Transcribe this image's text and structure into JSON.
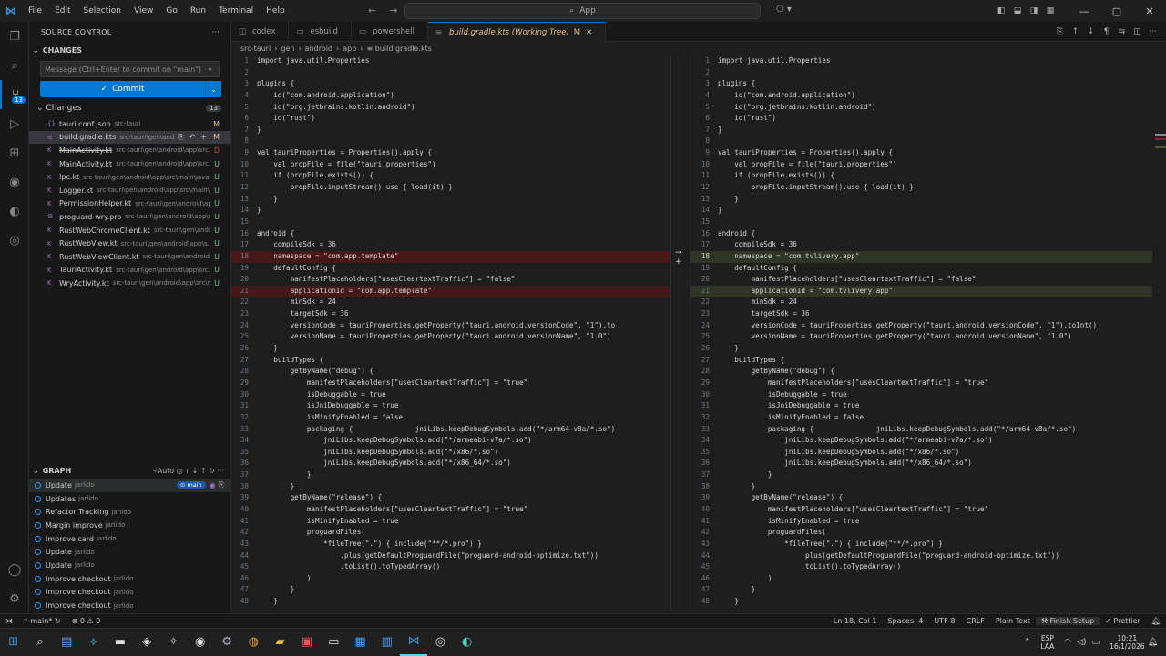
{
  "titlebar": {
    "menu": [
      "File",
      "Edit",
      "Selection",
      "View",
      "Go",
      "Run",
      "Terminal",
      "Help"
    ],
    "search": "App"
  },
  "scm": {
    "title": "SOURCE CONTROL",
    "section": "CHANGES",
    "message_placeholder": "Message (Ctrl+Enter to commit on \"main\")",
    "commit_label": "Commit",
    "changes_label": "Changes",
    "changes_count": "13",
    "files": [
      {
        "name": "tauri.conf.json",
        "path": "src-tauri",
        "status": "M",
        "icon": "{}",
        "deleted": false
      },
      {
        "name": "build.gradle.kts",
        "path": "src-tauri\\gen\\androi...",
        "status": "M",
        "icon": "≡",
        "deleted": false
      },
      {
        "name": "MainActivity.kt",
        "path": "src-tauri\\gen\\android\\app\\src...",
        "status": "D",
        "icon": "K",
        "deleted": true
      },
      {
        "name": "MainActivity.kt",
        "path": "src-tauri\\gen\\android\\app\\src...",
        "status": "U",
        "icon": "K",
        "deleted": false
      },
      {
        "name": "Ipc.kt",
        "path": "src-tauri\\gen\\android\\app\\src\\main\\java...",
        "status": "U",
        "icon": "K",
        "deleted": false
      },
      {
        "name": "Logger.kt",
        "path": "src-tauri\\gen\\android\\app\\src\\main\\j...",
        "status": "U",
        "icon": "K",
        "deleted": false
      },
      {
        "name": "PermissionHelper.kt",
        "path": "src-tauri\\gen\\android\\app...",
        "status": "U",
        "icon": "K",
        "deleted": false
      },
      {
        "name": "proguard-wry.pro",
        "path": "src-tauri\\gen\\android\\app\\s...",
        "status": "U",
        "icon": "⚙",
        "deleted": false
      },
      {
        "name": "RustWebChromeClient.kt",
        "path": "src-tauri\\gen\\androi...",
        "status": "U",
        "icon": "K",
        "deleted": false
      },
      {
        "name": "RustWebView.kt",
        "path": "src-tauri\\gen\\android\\app\\s...",
        "status": "U",
        "icon": "K",
        "deleted": false
      },
      {
        "name": "RustWebViewClient.kt",
        "path": "src-tauri\\gen\\android...",
        "status": "U",
        "icon": "K",
        "deleted": false
      },
      {
        "name": "TauriActivity.kt",
        "path": "src-tauri\\gen\\android\\app\\src...",
        "status": "U",
        "icon": "K",
        "deleted": false
      },
      {
        "name": "WryActivity.kt",
        "path": "src-tauri\\gen\\android\\app\\src\\m...",
        "status": "U",
        "icon": "K",
        "deleted": false
      }
    ],
    "graph_title": "GRAPH",
    "graph_auto": "Auto",
    "branch": "main",
    "commits": [
      {
        "msg": "Update",
        "author": "jarlido"
      },
      {
        "msg": "Updates",
        "author": "jarlido"
      },
      {
        "msg": "Refactor Tracking",
        "author": "jarlido"
      },
      {
        "msg": "Margin improve",
        "author": "jarlido"
      },
      {
        "msg": "Improve card",
        "author": "jarlido"
      },
      {
        "msg": "Update",
        "author": "jarlido"
      },
      {
        "msg": "Update",
        "author": "jarlido"
      },
      {
        "msg": "Improve checkout",
        "author": "jarlido"
      },
      {
        "msg": "Improve checkout",
        "author": "jarlido"
      },
      {
        "msg": "Improve checkout",
        "author": "jarlido"
      }
    ]
  },
  "tabs": [
    {
      "label": "codex",
      "icon": "◫",
      "active": false,
      "mod": "",
      "close": ""
    },
    {
      "label": "esbuild",
      "icon": "▭",
      "active": false,
      "mod": "",
      "close": ""
    },
    {
      "label": "powershell",
      "icon": "▭",
      "active": false,
      "mod": "",
      "close": ""
    },
    {
      "label": "build.gradle.kts (Working Tree)",
      "icon": "≡",
      "active": true,
      "mod": "M",
      "close": "✕"
    }
  ],
  "breadcrumb": [
    "src-tauri",
    "›",
    "gen",
    "›",
    "android",
    "›",
    "app",
    "›",
    "≡ build.gradle.kts"
  ],
  "diff": {
    "left": [
      {
        "n": "1",
        "t": "import java.util.Properties"
      },
      {
        "n": "2",
        "t": ""
      },
      {
        "n": "3",
        "t": "plugins {"
      },
      {
        "n": "4",
        "t": "    id(\"com.android.application\")"
      },
      {
        "n": "5",
        "t": "    id(\"org.jetbrains.kotlin.android\")"
      },
      {
        "n": "6",
        "t": "    id(\"rust\")"
      },
      {
        "n": "7",
        "t": "}"
      },
      {
        "n": "8",
        "t": ""
      },
      {
        "n": "9",
        "t": "val tauriProperties = Properties().apply {"
      },
      {
        "n": "10",
        "t": "    val propFile = file(\"tauri.properties\")"
      },
      {
        "n": "11",
        "t": "    if (propFile.exists()) {"
      },
      {
        "n": "12",
        "t": "        propFile.inputStream().use { load(it) }"
      },
      {
        "n": "13",
        "t": "    }"
      },
      {
        "n": "14",
        "t": "}"
      },
      {
        "n": "15",
        "t": ""
      },
      {
        "n": "16",
        "t": "android {"
      },
      {
        "n": "17",
        "t": "    compileSdk = 36"
      },
      {
        "n": "18",
        "t": "    namespace = \"com.app.template\"",
        "c": "del"
      },
      {
        "n": "19",
        "t": "    defaultConfig {"
      },
      {
        "n": "20",
        "t": "        manifestPlaceholders[\"usesCleartextTraffic\"] = \"false\""
      },
      {
        "n": "21",
        "t": "        applicationId = \"com.app.template\"",
        "c": "del"
      },
      {
        "n": "22",
        "t": "        minSdk = 24"
      },
      {
        "n": "23",
        "t": "        targetSdk = 36"
      },
      {
        "n": "24",
        "t": "        versionCode = tauriProperties.getProperty(\"tauri.android.versionCode\", \"1\").to"
      },
      {
        "n": "25",
        "t": "        versionName = tauriProperties.getProperty(\"tauri.android.versionName\", \"1.0\")"
      },
      {
        "n": "26",
        "t": "    }"
      },
      {
        "n": "27",
        "t": "    buildTypes {"
      },
      {
        "n": "28",
        "t": "        getByName(\"debug\") {"
      },
      {
        "n": "29",
        "t": "            manifestPlaceholders[\"usesCleartextTraffic\"] = \"true\""
      },
      {
        "n": "30",
        "t": "            isDebuggable = true"
      },
      {
        "n": "31",
        "t": "            isJniDebuggable = true"
      },
      {
        "n": "32",
        "t": "            isMinifyEnabled = false"
      },
      {
        "n": "33",
        "t": "            packaging {               jniLibs.keepDebugSymbols.add(\"*/arm64-v8a/*.so\")"
      },
      {
        "n": "34",
        "t": "                jniLibs.keepDebugSymbols.add(\"*/armeabi-v7a/*.so\")"
      },
      {
        "n": "35",
        "t": "                jniLibs.keepDebugSymbols.add(\"*/x86/*.so\")"
      },
      {
        "n": "36",
        "t": "                jniLibs.keepDebugSymbols.add(\"*/x86_64/*.so\")"
      },
      {
        "n": "37",
        "t": "            }"
      },
      {
        "n": "38",
        "t": "        }"
      },
      {
        "n": "39",
        "t": "        getByName(\"release\") {"
      },
      {
        "n": "40",
        "t": "            manifestPlaceholders[\"usesCleartextTraffic\"] = \"true\""
      },
      {
        "n": "41",
        "t": "            isMinifyEnabled = true"
      },
      {
        "n": "42",
        "t": "            proguardFiles("
      },
      {
        "n": "43",
        "t": "                *fileTree(\".\") { include(\"**/*.pro\") }"
      },
      {
        "n": "44",
        "t": "                    .plus(getDefaultProguardFile(\"proguard-android-optimize.txt\"))"
      },
      {
        "n": "45",
        "t": "                    .toList().toTypedArray()"
      },
      {
        "n": "46",
        "t": "            )"
      },
      {
        "n": "47",
        "t": "        }"
      },
      {
        "n": "48",
        "t": "    }"
      }
    ],
    "right": [
      {
        "n": "1",
        "t": "import java.util.Properties"
      },
      {
        "n": "2",
        "t": ""
      },
      {
        "n": "3",
        "t": "plugins {"
      },
      {
        "n": "4",
        "t": "    id(\"com.android.application\")"
      },
      {
        "n": "5",
        "t": "    id(\"org.jetbrains.kotlin.android\")"
      },
      {
        "n": "6",
        "t": "    id(\"rust\")"
      },
      {
        "n": "7",
        "t": "}"
      },
      {
        "n": "8",
        "t": ""
      },
      {
        "n": "9",
        "t": "val tauriProperties = Properties().apply {"
      },
      {
        "n": "10",
        "t": "    val propFile = file(\"tauri.properties\")"
      },
      {
        "n": "11",
        "t": "    if (propFile.exists()) {"
      },
      {
        "n": "12",
        "t": "        propFile.inputStream().use { load(it) }"
      },
      {
        "n": "13",
        "t": "    }"
      },
      {
        "n": "14",
        "t": "}"
      },
      {
        "n": "15",
        "t": ""
      },
      {
        "n": "16",
        "t": "android {"
      },
      {
        "n": "17",
        "t": "    compileSdk = 36"
      },
      {
        "n": "18",
        "t": "    namespace = \"com.tvlivery.app\"",
        "c": "ins cur"
      },
      {
        "n": "19",
        "t": "    defaultConfig {"
      },
      {
        "n": "20",
        "t": "        manifestPlaceholders[\"usesCleartextTraffic\"] = \"false\""
      },
      {
        "n": "21",
        "t": "        applicationId = \"com.tvlivery.app\"",
        "c": "ins"
      },
      {
        "n": "22",
        "t": "        minSdk = 24"
      },
      {
        "n": "23",
        "t": "        targetSdk = 36"
      },
      {
        "n": "24",
        "t": "        versionCode = tauriProperties.getProperty(\"tauri.android.versionCode\", \"1\").toInt()"
      },
      {
        "n": "25",
        "t": "        versionName = tauriProperties.getProperty(\"tauri.android.versionName\", \"1.0\")"
      },
      {
        "n": "26",
        "t": "    }"
      },
      {
        "n": "27",
        "t": "    buildTypes {"
      },
      {
        "n": "28",
        "t": "        getByName(\"debug\") {"
      },
      {
        "n": "29",
        "t": "            manifestPlaceholders[\"usesCleartextTraffic\"] = \"true\""
      },
      {
        "n": "30",
        "t": "            isDebuggable = true"
      },
      {
        "n": "31",
        "t": "            isJniDebuggable = true"
      },
      {
        "n": "32",
        "t": "            isMinifyEnabled = false"
      },
      {
        "n": "33",
        "t": "            packaging {               jniLibs.keepDebugSymbols.add(\"*/arm64-v8a/*.so\")"
      },
      {
        "n": "34",
        "t": "                jniLibs.keepDebugSymbols.add(\"*/armeabi-v7a/*.so\")"
      },
      {
        "n": "35",
        "t": "                jniLibs.keepDebugSymbols.add(\"*/x86/*.so\")"
      },
      {
        "n": "36",
        "t": "                jniLibs.keepDebugSymbols.add(\"*/x86_64/*.so\")"
      },
      {
        "n": "37",
        "t": "            }"
      },
      {
        "n": "38",
        "t": "        }"
      },
      {
        "n": "39",
        "t": "        getByName(\"release\") {"
      },
      {
        "n": "40",
        "t": "            manifestPlaceholders[\"usesCleartextTraffic\"] = \"true\""
      },
      {
        "n": "41",
        "t": "            isMinifyEnabled = true"
      },
      {
        "n": "42",
        "t": "            proguardFiles("
      },
      {
        "n": "43",
        "t": "                *fileTree(\".\") { include(\"**/*.pro\") }"
      },
      {
        "n": "44",
        "t": "                    .plus(getDefaultProguardFile(\"proguard-android-optimize.txt\"))"
      },
      {
        "n": "45",
        "t": "                    .toList().toTypedArray()"
      },
      {
        "n": "46",
        "t": "            )"
      },
      {
        "n": "47",
        "t": "        }"
      },
      {
        "n": "48",
        "t": "    }"
      }
    ]
  },
  "status": {
    "branch": "main*",
    "problems": "⊗ 0 ⚠ 0",
    "position": "Ln 18, Col 1",
    "spaces": "Spaces: 4",
    "encoding": "UTF-8",
    "eol": "CRLF",
    "language": "Plain Text",
    "finish": "Finish Setup",
    "prettier": "Prettier"
  },
  "tray": {
    "lang1": "ESP",
    "lang2": "LAA",
    "time": "10:21",
    "date": "16/1/2026"
  },
  "colors": {
    "accent": "#0078d4",
    "deleted": "#4b1818",
    "inserted": "#373d29"
  }
}
